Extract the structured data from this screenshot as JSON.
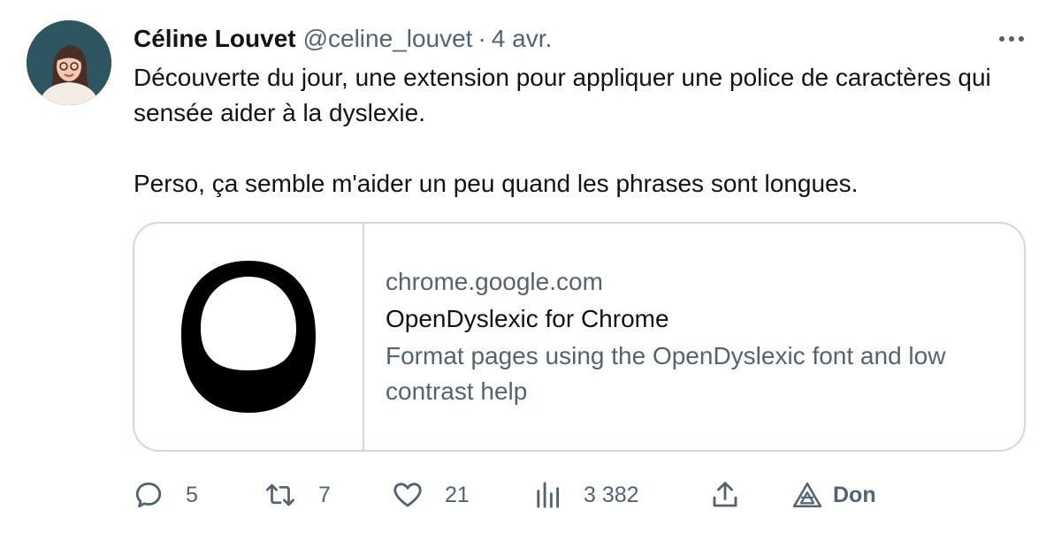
{
  "tweet": {
    "author_name": "Céline Louvet",
    "handle": "@celine_louvet",
    "separator": "·",
    "date": "4 avr.",
    "text_line_1": "Découverte du jour, une extension pour appliquer une police de caractères qui sensée aider à la dyslexie.",
    "text_line_2": "Perso, ça semble m'aider un peu quand les phrases sont longues."
  },
  "card": {
    "domain": "chrome.google.com",
    "title": "OpenDyslexic for Chrome",
    "description": "Format pages using the OpenDyslexic font and low contrast help",
    "thumbnail_icon": "opendyslexic-o-logo"
  },
  "actions": {
    "reply_count": "5",
    "retweet_count": "7",
    "like_count": "21",
    "views_count": "3 382",
    "donate_label": "Don"
  },
  "icons": {
    "more": "more-icon",
    "reply": "reply-icon",
    "retweet": "retweet-icon",
    "like": "heart-icon",
    "views": "views-icon",
    "share": "share-icon",
    "donate": "donate-icon"
  },
  "colors": {
    "text_primary": "#0f1419",
    "text_secondary": "#536471",
    "border": "#cfd9de"
  }
}
